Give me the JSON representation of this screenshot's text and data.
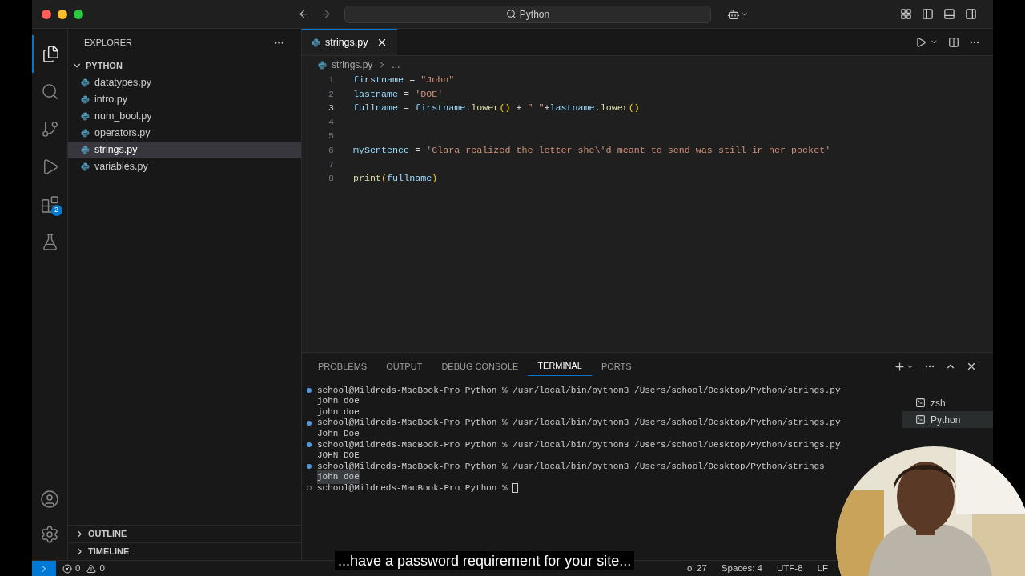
{
  "title_bar": {
    "search": "Python"
  },
  "activity_bar": {
    "items": [
      {
        "kind": "explorer",
        "selected": true
      },
      {
        "kind": "search",
        "selected": false
      },
      {
        "kind": "source-control",
        "selected": false
      },
      {
        "kind": "run",
        "selected": false
      },
      {
        "kind": "extensions",
        "selected": false,
        "badge": "2"
      },
      {
        "kind": "testing",
        "selected": false
      }
    ]
  },
  "sidebar": {
    "title": "EXPLORER",
    "folder": {
      "name": "PYTHON",
      "expanded": true,
      "files": [
        {
          "name": "datatypes.py",
          "selected": false
        },
        {
          "name": "intro.py",
          "selected": false
        },
        {
          "name": "num_bool.py",
          "selected": false
        },
        {
          "name": "operators.py",
          "selected": false
        },
        {
          "name": "strings.py",
          "selected": true
        },
        {
          "name": "variables.py",
          "selected": false
        }
      ]
    },
    "sections": [
      {
        "name": "OUTLINE",
        "expanded": false
      },
      {
        "name": "TIMELINE",
        "expanded": false
      }
    ]
  },
  "editor": {
    "tabs": [
      {
        "name": "strings.py",
        "selected": true
      }
    ],
    "breadcrumb": [
      "strings.py",
      "..."
    ],
    "lines": [
      {
        "number": "1",
        "current": false,
        "tokens": [
          {
            "kind": "var",
            "text": "firstname"
          },
          {
            "kind": "op",
            "text": " = "
          },
          {
            "kind": "str",
            "text": "\"John\""
          }
        ]
      },
      {
        "number": "2",
        "current": false,
        "tokens": [
          {
            "kind": "var",
            "text": "lastname"
          },
          {
            "kind": "op",
            "text": " = "
          },
          {
            "kind": "str",
            "text": "'DOE'"
          }
        ]
      },
      {
        "number": "3",
        "current": true,
        "tokens": [
          {
            "kind": "var",
            "text": "fullname"
          },
          {
            "kind": "op",
            "text": " = "
          },
          {
            "kind": "var",
            "text": "firstname"
          },
          {
            "kind": "op",
            "text": "."
          },
          {
            "kind": "fn",
            "text": "lower"
          },
          {
            "kind": "paren",
            "text": "()"
          },
          {
            "kind": "op",
            "text": " + "
          },
          {
            "kind": "str",
            "text": "\" \""
          },
          {
            "kind": "op",
            "text": "+"
          },
          {
            "kind": "var",
            "text": "lastname"
          },
          {
            "kind": "op",
            "text": "."
          },
          {
            "kind": "fn",
            "text": "lower"
          },
          {
            "kind": "paren",
            "text": "()"
          }
        ]
      },
      {
        "number": "4",
        "current": false
      },
      {
        "number": "5",
        "current": false
      },
      {
        "number": "6",
        "current": false,
        "tokens": [
          {
            "kind": "var",
            "text": "mySentence"
          },
          {
            "kind": "op",
            "text": " = "
          },
          {
            "kind": "str",
            "text": "'Clara realized the letter she\\'d meant to send was still in her pocket'"
          }
        ]
      },
      {
        "number": "7",
        "current": false
      },
      {
        "number": "8",
        "current": false,
        "tokens": [
          {
            "kind": "fn",
            "text": "print"
          },
          {
            "kind": "paren",
            "text": "("
          },
          {
            "kind": "var",
            "text": "fullname"
          },
          {
            "kind": "paren",
            "text": ")"
          }
        ]
      }
    ]
  },
  "panel": {
    "tabs": [
      {
        "label": "PROBLEMS",
        "selected": false
      },
      {
        "label": "OUTPUT",
        "selected": false
      },
      {
        "label": "DEBUG CONSOLE",
        "selected": false
      },
      {
        "label": "TERMINAL",
        "selected": true
      },
      {
        "label": "PORTS",
        "selected": false
      }
    ],
    "terminal": {
      "lines": [
        {
          "kind": "prompt",
          "done": true,
          "text": "school@Mildreds-MacBook-Pro Python % /usr/local/bin/python3 /Users/school/Desktop/Python/strings.py"
        },
        {
          "kind": "output",
          "selected": false,
          "text": "john doe"
        },
        {
          "kind": "output",
          "selected": false,
          "text": "john doe"
        },
        {
          "kind": "prompt",
          "done": true,
          "text": "school@Mildreds-MacBook-Pro Python % /usr/local/bin/python3 /Users/school/Desktop/Python/strings.py"
        },
        {
          "kind": "output",
          "selected": false,
          "text": "John Doe"
        },
        {
          "kind": "prompt",
          "done": true,
          "text": "school@Mildreds-MacBook-Pro Python % /usr/local/bin/python3 /Users/school/Desktop/Python/strings.py"
        },
        {
          "kind": "output",
          "selected": false,
          "text": "JOHN DOE"
        },
        {
          "kind": "prompt",
          "done": true,
          "text": "school@Mildreds-MacBook-Pro Python % /usr/local/bin/python3 /Users/school/Desktop/Python/strings"
        },
        {
          "kind": "output",
          "selected": true,
          "text": "john doe"
        },
        {
          "kind": "prompt",
          "done": false,
          "cursor": true,
          "text": "school@Mildreds-MacBook-Pro Python % "
        }
      ]
    },
    "shells": [
      {
        "name": "zsh",
        "selected": false
      },
      {
        "name": "Python",
        "selected": true
      }
    ]
  },
  "status_bar": {
    "errors": "0",
    "warnings": "0",
    "items": [
      "ol 27",
      "Spaces: 4",
      "UTF-8",
      "LF"
    ]
  },
  "caption": "...have a password requirement for your site..."
}
